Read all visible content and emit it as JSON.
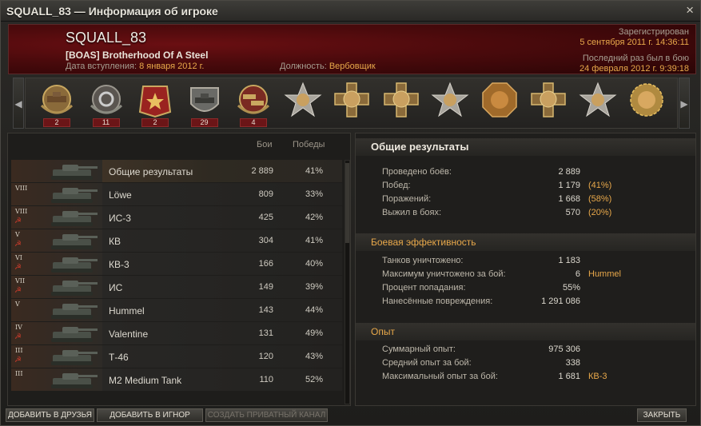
{
  "window": {
    "title": "SQUALL_83 — Информация об игроке",
    "close_glyph": "×"
  },
  "header": {
    "nickname": "SQUALL_83",
    "clan": "[BOAS] Brotherhood Of A Steel",
    "joined_label": "Дата вступления:",
    "joined_value": "8 января 2012 г.",
    "role_label": "Должность:",
    "role_value": "Вербовщик",
    "registered_label": "Зарегистрирован",
    "registered_value": "5 сентября 2011 г. 14:36:11",
    "last_seen_label": "Последний раз был в бою",
    "last_seen_value": "24 февраля 2012 г. 9:39:18"
  },
  "medals": [
    {
      "icon": "tank-wreath-medal-icon",
      "count": "2"
    },
    {
      "icon": "wheel-wreath-medal-icon",
      "count": "11"
    },
    {
      "icon": "red-banner-medal-icon",
      "count": "2"
    },
    {
      "icon": "tank-shield-medal-icon",
      "count": "29"
    },
    {
      "icon": "tanks-wreath-medal-icon",
      "count": "4"
    },
    {
      "icon": "star-portrait-medal-icon",
      "count": ""
    },
    {
      "icon": "cross-portrait-medal-icon",
      "count": ""
    },
    {
      "icon": "cross-portrait-medal-icon",
      "count": ""
    },
    {
      "icon": "star-portrait-medal-icon",
      "count": ""
    },
    {
      "icon": "octagon-portrait-medal-icon",
      "count": ""
    },
    {
      "icon": "cross-portrait-medal-icon",
      "count": ""
    },
    {
      "icon": "star-portrait-medal-icon",
      "count": ""
    },
    {
      "icon": "sun-portrait-medal-icon",
      "count": ""
    }
  ],
  "table": {
    "col_battles": "Бои",
    "col_wins": "Победы",
    "rows": [
      {
        "tier": "",
        "flag": "",
        "name": "Общие результаты",
        "battles": "2 889",
        "wins": "41%",
        "selected": true
      },
      {
        "tier": "VIII",
        "flag": "",
        "name": "Löwe",
        "battles": "809",
        "wins": "33%"
      },
      {
        "tier": "VIII",
        "flag": "☭",
        "name": "ИС-3",
        "battles": "425",
        "wins": "42%"
      },
      {
        "tier": "V",
        "flag": "☭",
        "name": "КВ",
        "battles": "304",
        "wins": "41%"
      },
      {
        "tier": "VI",
        "flag": "☭",
        "name": "КВ-3",
        "battles": "166",
        "wins": "40%"
      },
      {
        "tier": "VII",
        "flag": "☭",
        "name": "ИС",
        "battles": "149",
        "wins": "39%"
      },
      {
        "tier": "V",
        "flag": "",
        "name": "Hummel",
        "battles": "143",
        "wins": "44%"
      },
      {
        "tier": "IV",
        "flag": "☭",
        "name": "Valentine",
        "battles": "131",
        "wins": "49%"
      },
      {
        "tier": "III",
        "flag": "☭",
        "name": "Т-46",
        "battles": "120",
        "wins": "43%"
      },
      {
        "tier": "III",
        "flag": "",
        "name": "M2 Medium Tank",
        "battles": "110",
        "wins": "52%"
      }
    ]
  },
  "stats": {
    "overall_title": "Общие результаты",
    "battles_label": "Проведено боёв:",
    "battles_value": "2 889",
    "wins_label": "Побед:",
    "wins_value": "1 179",
    "wins_pct": "(41%)",
    "losses_label": "Поражений:",
    "losses_value": "1 668",
    "losses_pct": "(58%)",
    "survived_label": "Выжил в боях:",
    "survived_value": "570",
    "survived_pct": "(20%)",
    "combat_title": "Боевая эффективность",
    "kills_label": "Танков уничтожено:",
    "kills_value": "1 183",
    "max_kills_label": "Максимум уничтожено за бой:",
    "max_kills_value": "6",
    "max_kills_tank": "Hummel",
    "hit_label": "Процент попадания:",
    "hit_value": "55%",
    "damage_label": "Нанесённые повреждения:",
    "damage_value": "1 291 086",
    "exp_title": "Опыт",
    "total_exp_label": "Суммарный опыт:",
    "total_exp_value": "975 306",
    "avg_exp_label": "Средний опыт за бой:",
    "avg_exp_value": "338",
    "max_exp_label": "Максимальный опыт за бой:",
    "max_exp_value": "1 681",
    "max_exp_tank": "КВ-3"
  },
  "buttons": {
    "add_friend": "ДОБАВИТЬ В ДРУЗЬЯ",
    "add_ignore": "ДОБАВИТЬ В ИГНОР",
    "create_channel": "СОЗДАТЬ ПРИВАТНЫЙ КАНАЛ",
    "close": "ЗАКРЫТЬ"
  },
  "colors": {
    "accent": "#e8a84a",
    "header_red": "#6a0f12",
    "badge_red": "#6b1517"
  }
}
